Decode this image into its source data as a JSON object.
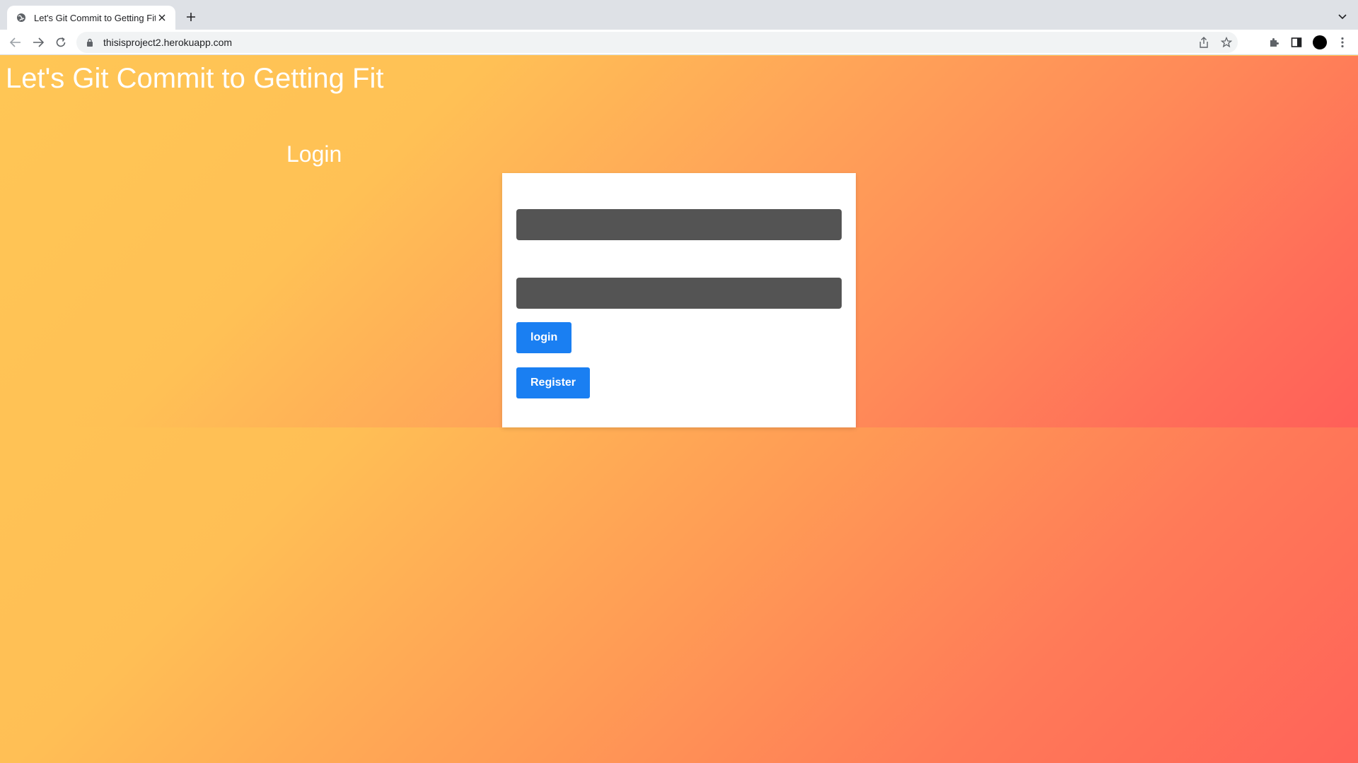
{
  "browser": {
    "tab_title": "Let's Git Commit to Getting Fit",
    "url": "thisisproject2.herokuapp.com"
  },
  "page": {
    "site_title": "Let's Git Commit to Getting Fit",
    "login_heading": "Login",
    "form": {
      "username_value": "",
      "password_value": "",
      "login_label": "login",
      "register_label": "Register"
    }
  },
  "colors": {
    "gradient_start": "#ffc655",
    "gradient_end": "#ff6359",
    "button_blue": "#1a7ff2",
    "input_bg": "#545454"
  }
}
